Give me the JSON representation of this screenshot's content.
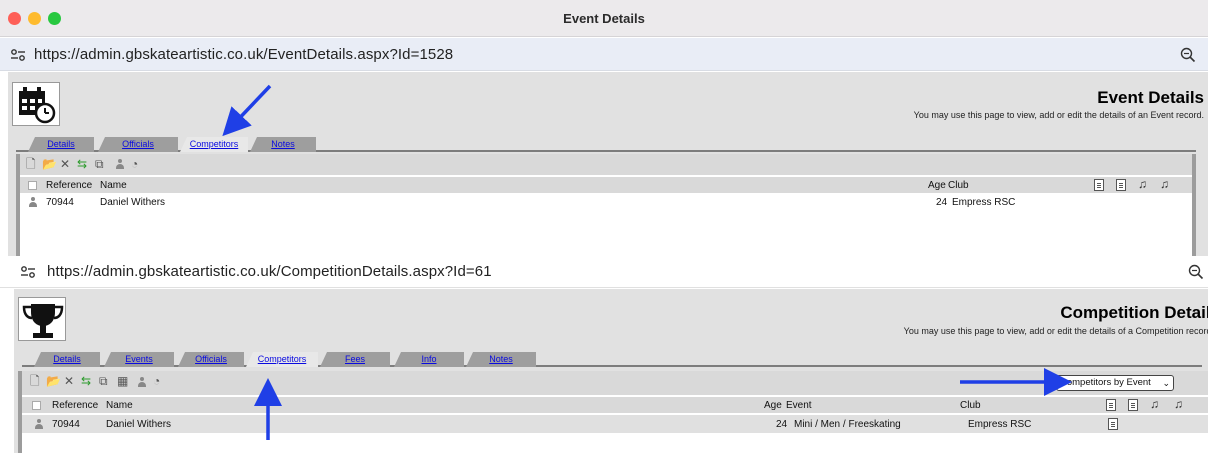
{
  "window": {
    "title": "Event Details"
  },
  "top": {
    "url": "https://admin.gbskateartistic.co.uk/EventDetails.aspx?Id=1528",
    "page_title": "Event Details",
    "subtitle": "You may use this page to view, add or edit the details of an Event record.",
    "tabs": [
      {
        "label": "Details"
      },
      {
        "label": "Officials"
      },
      {
        "label": "Competitors"
      },
      {
        "label": "Notes"
      }
    ],
    "columns": {
      "reference": "Reference",
      "name": "Name",
      "age": "Age",
      "club": "Club"
    },
    "rows": [
      {
        "reference": "70944",
        "name": "Daniel Withers",
        "age": "24",
        "club": "Empress RSC"
      }
    ]
  },
  "bottom": {
    "url": "https://admin.gbskateartistic.co.uk/CompetitionDetails.aspx?Id=61",
    "page_title": "Competition Details",
    "subtitle": "You may use this page to view, add or edit the details of a Competition record.",
    "tabs": [
      {
        "label": "Details"
      },
      {
        "label": "Events"
      },
      {
        "label": "Officials"
      },
      {
        "label": "Competitors"
      },
      {
        "label": "Fees"
      },
      {
        "label": "Info"
      },
      {
        "label": "Notes"
      }
    ],
    "view_select": "Competitors by Event",
    "columns": {
      "reference": "Reference",
      "name": "Name",
      "age": "Age",
      "event": "Event",
      "club": "Club"
    },
    "rows": [
      {
        "reference": "70944",
        "name": "Daniel Withers",
        "age": "24",
        "event": "Mini / Men / Freeskating",
        "club": "Empress RSC"
      }
    ]
  },
  "colors": {
    "annotation_arrow": "#1f3fe6",
    "active_tab": "#e8e8e8",
    "tab": "#9e9e9e",
    "link": "#0a0ae0"
  }
}
